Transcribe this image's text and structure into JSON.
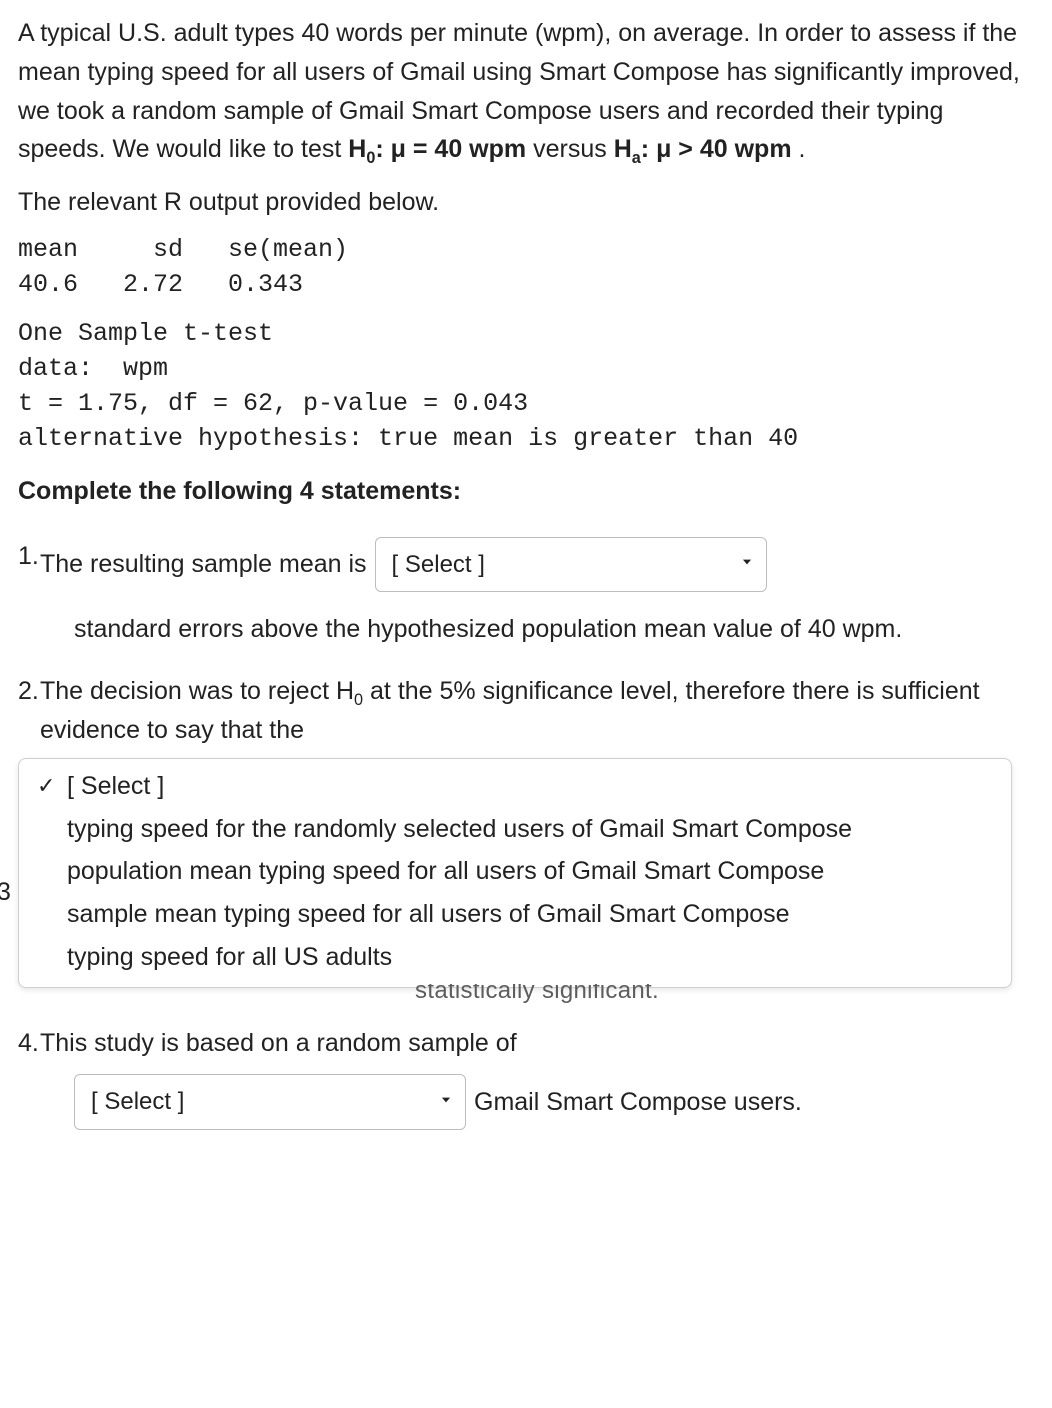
{
  "intro": {
    "text_a": "A typical U.S. adult types 40 words per minute (wpm), on average.  In order to assess if the mean typing speed for all users of Gmail using Smart Compose has significantly improved, we took a random sample of Gmail Smart Compose users and recorded their typing speeds.  We would like to test ",
    "h0_label": "H",
    "h0_sub": "0",
    "h0_body": ": μ = 40 wpm",
    "versus": " versus ",
    "ha_label": "H",
    "ha_sub": "a",
    "ha_body": ": μ > 40 wpm",
    "period": "."
  },
  "para2": "The relevant R output  provided below.",
  "r_output": {
    "header": "mean     sd   se(mean)",
    "values": "40.6   2.72   0.343",
    "block2_l1": "One Sample t-test",
    "block2_l2": "data:  wpm",
    "block2_l3": "t = 1.75, df = 62, p-value = 0.043",
    "block2_l4": "alternative hypothesis: true mean is greater than 40"
  },
  "prompt": "Complete the following 4 statements:",
  "statements": {
    "s1": {
      "num": "1.",
      "before": "The resulting sample mean is",
      "select_placeholder": "[ Select ]",
      "after": "standard errors above the hypothesized population mean value of 40 wpm."
    },
    "s2": {
      "num": "2.",
      "line1_a": "The decision was to reject H",
      "line1_sub": "0",
      "line1_b": " at the 5% significance level, therefore there is sufficient evidence to say that the"
    },
    "dropdown": {
      "opt0": "[ Select ]",
      "opt1": "typing speed for the randomly selected users of Gmail Smart Compose",
      "opt2": "population mean typing speed for all users of Gmail Smart Compose",
      "opt3": "sample mean typing speed for all users of Gmail Smart Compose",
      "opt4": "typing speed for all US adults"
    },
    "s3_marker": "3",
    "obscured": "statistically significant.",
    "s4": {
      "num": "4.",
      "before": "This study is based on a random sample of",
      "select_placeholder": "[ Select ]",
      "after": "Gmail Smart Compose users."
    }
  }
}
